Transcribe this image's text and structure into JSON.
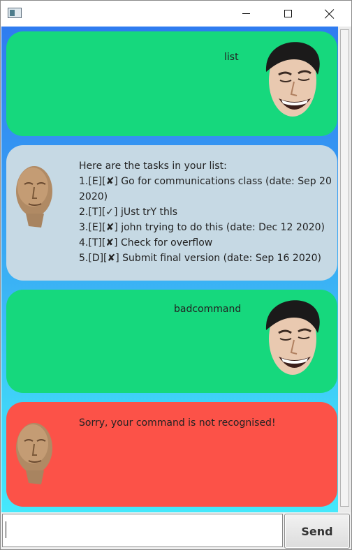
{
  "window": {
    "icons": {
      "app": "app-window-icon",
      "minimize": "minimize-icon",
      "maximize": "maximize-icon",
      "close": "close-icon"
    }
  },
  "messages": [
    {
      "sender": "user",
      "text": "list",
      "avatar": "laughing-man-avatar"
    },
    {
      "sender": "duke",
      "avatar": "meme-man-avatar",
      "lines": [
        "Here are the tasks in your list:",
        "1.[E][✘] Go for communications class (date: Sep 20",
        "2020)",
        "2.[T][✓] jUst trY thls",
        "3.[E][✘] john trying to do this (date: Dec 12 2020)",
        "4.[T][✘] Check for overflow",
        "5.[D][✘] Submit final version (date: Sep 16 2020)"
      ]
    },
    {
      "sender": "user",
      "text": "badcommand",
      "avatar": "laughing-man-avatar"
    },
    {
      "sender": "duke",
      "avatar": "meme-man-avatar",
      "text": "Sorry, your command is not recognised!"
    }
  ],
  "input": {
    "value": "",
    "placeholder": ""
  },
  "send": {
    "label": "Send"
  },
  "colors": {
    "user_bubble": "#16d87d",
    "duke_bubble": "#c6d9e4",
    "error_bubble": "#fc5248",
    "background_top": "#2f7cf0",
    "background_bottom": "#45e8fb"
  }
}
